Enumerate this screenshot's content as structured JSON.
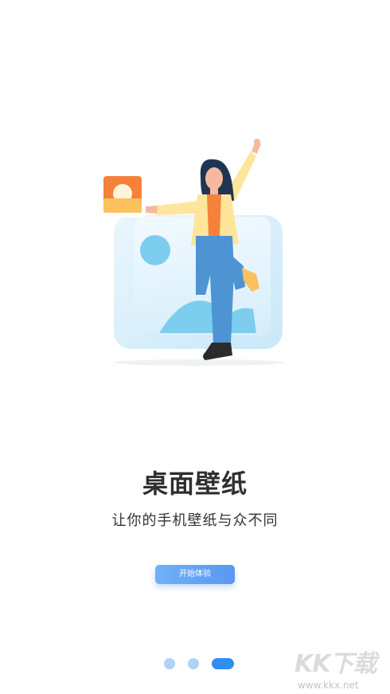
{
  "page": {
    "title": "桌面壁纸",
    "subtitle": "让你的手机壁纸与众不同",
    "start_button_label": "开始体验"
  },
  "pagination": {
    "total": 3,
    "active_index": 2
  },
  "watermark": {
    "logo_text": "KK下载",
    "url": "www.kkx.net"
  },
  "illustration": {
    "icons": [
      "wallpaper-app-icon",
      "picture-frame-icon",
      "woman-figure"
    ]
  },
  "colors": {
    "accent": "#2f8ef0",
    "dot_inactive": "#aed3f7",
    "button_start": "#6fb1f7",
    "button_end": "#5a98f0",
    "title": "#2f2f2f"
  }
}
